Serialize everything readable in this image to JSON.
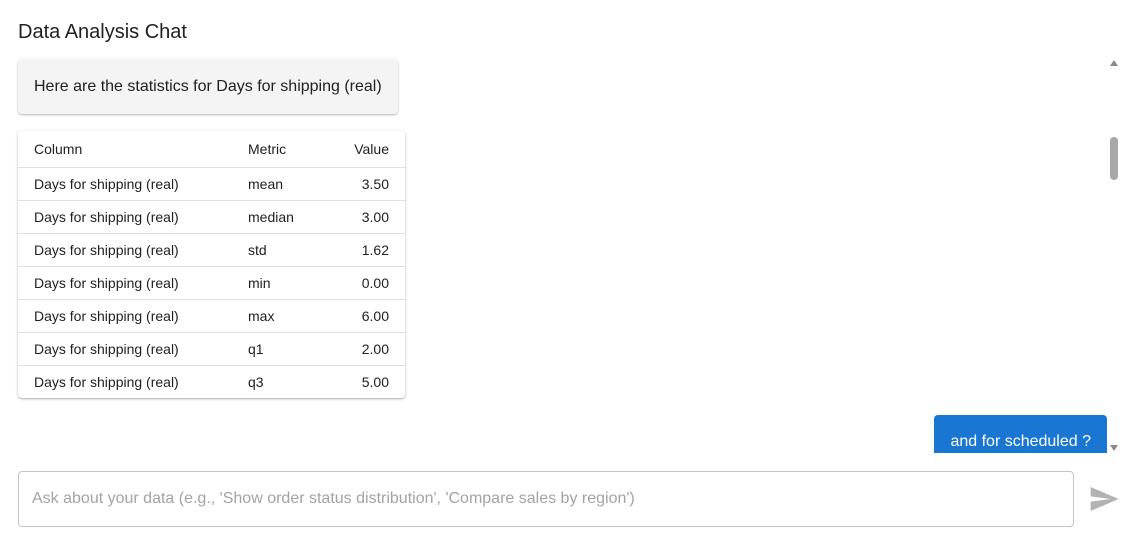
{
  "header": {
    "title": "Data Analysis Chat"
  },
  "messages": {
    "bot_text": "Here are the statistics for Days for shipping (real)",
    "user_text": "and for scheduled ?"
  },
  "stats_table": {
    "headers": {
      "column": "Column",
      "metric": "Metric",
      "value": "Value"
    },
    "rows": [
      {
        "column": "Days for shipping (real)",
        "metric": "mean",
        "value": "3.50"
      },
      {
        "column": "Days for shipping (real)",
        "metric": "median",
        "value": "3.00"
      },
      {
        "column": "Days for shipping (real)",
        "metric": "std",
        "value": "1.62"
      },
      {
        "column": "Days for shipping (real)",
        "metric": "min",
        "value": "0.00"
      },
      {
        "column": "Days for shipping (real)",
        "metric": "max",
        "value": "6.00"
      },
      {
        "column": "Days for shipping (real)",
        "metric": "q1",
        "value": "2.00"
      },
      {
        "column": "Days for shipping (real)",
        "metric": "q3",
        "value": "5.00"
      }
    ]
  },
  "input": {
    "value": "",
    "placeholder": "Ask about your data (e.g., 'Show order status distribution', 'Compare sales by region')"
  },
  "icons": {
    "send": "send-icon"
  },
  "colors": {
    "accent": "#1976d2",
    "bot_bubble": "#f4f4f4",
    "send_icon": "#b3b3b3"
  }
}
